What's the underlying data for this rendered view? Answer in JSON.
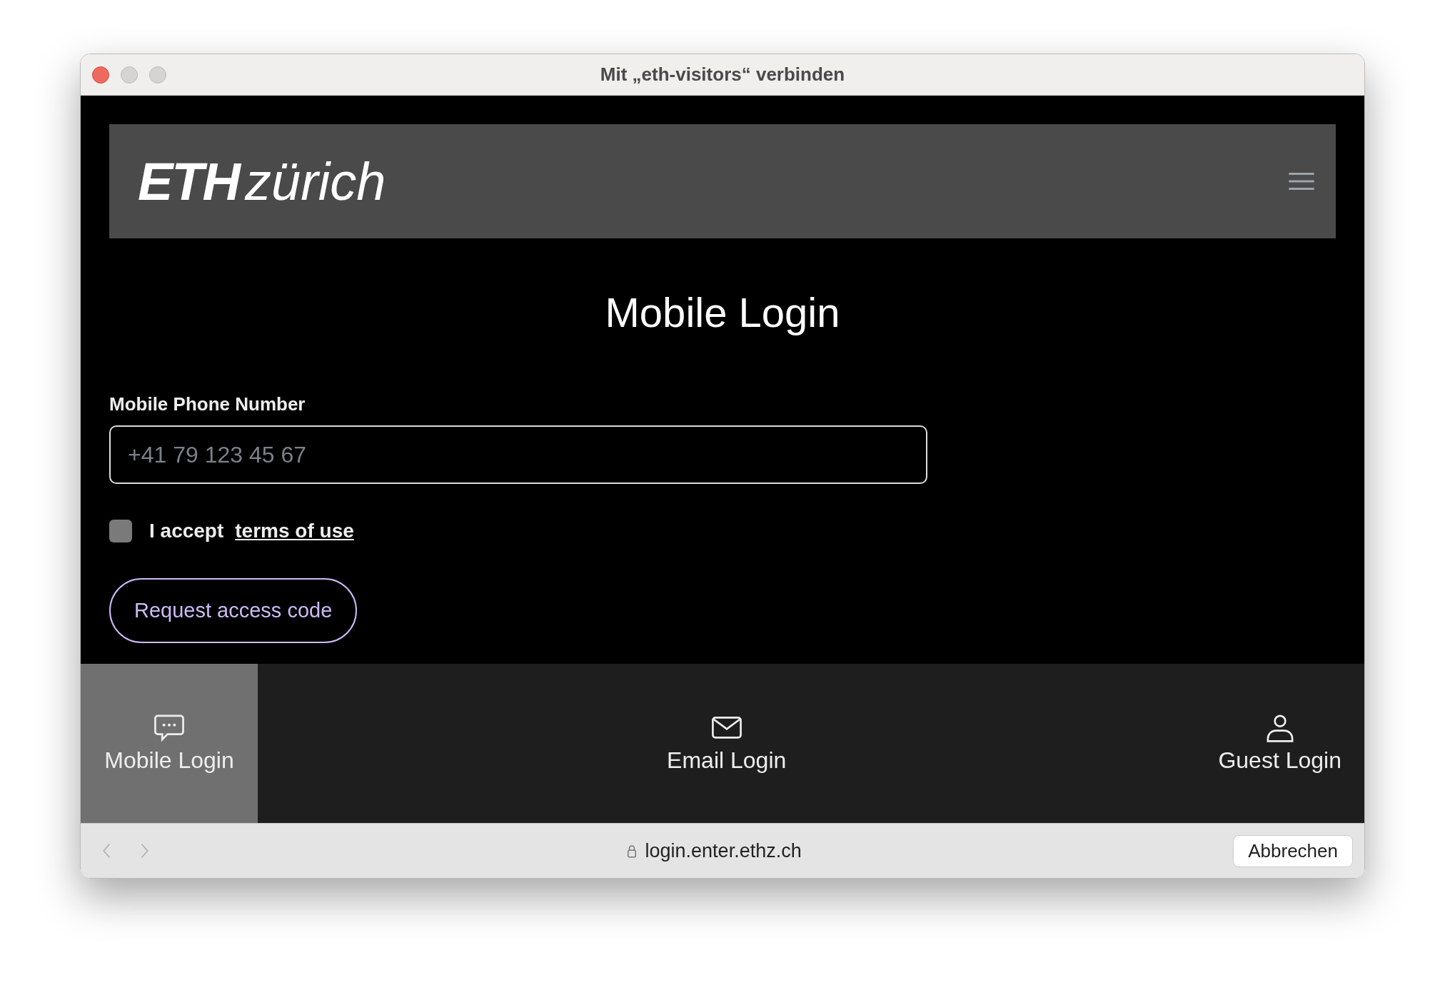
{
  "window": {
    "title": "Mit „eth-visitors“ verbinden"
  },
  "header": {
    "logo_bold": "ETH",
    "logo_light": "zürich"
  },
  "heading": "Mobile Login",
  "phone_field": {
    "label": "Mobile Phone Number",
    "placeholder": "+41 79 123 45 67"
  },
  "terms": {
    "text": "I accept",
    "link": "terms of use",
    "checked": false
  },
  "submit_button": "Request access code",
  "login_tabs": [
    {
      "kind": "chat",
      "label": "Mobile Login",
      "selected": true
    },
    {
      "kind": "mail",
      "label": "Email Login",
      "selected": false
    },
    {
      "kind": "person",
      "label": "Guest Login",
      "selected": false
    }
  ],
  "status_bar": {
    "url": "login.enter.ethz.ch",
    "cancel_button": "Abbrechen"
  }
}
